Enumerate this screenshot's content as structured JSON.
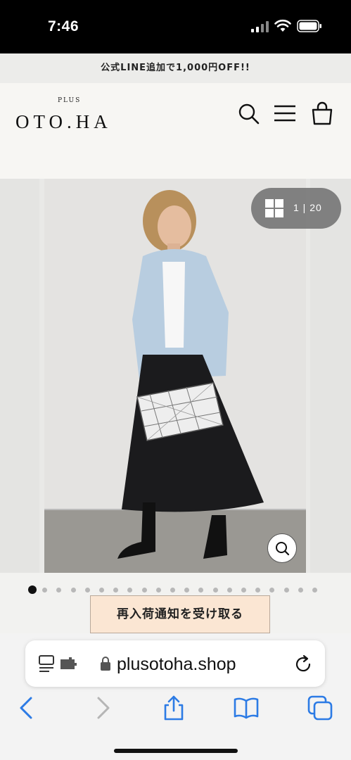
{
  "status_bar": {
    "time": "7:46"
  },
  "promo": {
    "text": "公式LINE追加で1,000円OFF!!"
  },
  "header": {
    "logo_small": "PLUS",
    "logo": "OTO.HA",
    "icons": [
      "search-icon",
      "menu-icon",
      "shopping-bag-icon"
    ]
  },
  "gallery": {
    "counter": "1 | 20",
    "current_image": 1,
    "total_images": 20,
    "dot_count": 21,
    "active_dot": 0
  },
  "product": {
    "restock_label": "再入荷通知を受け取る"
  },
  "browser": {
    "url": "plusotoha.shop",
    "toolbar_icons": [
      "back-icon",
      "forward-icon",
      "share-icon",
      "bookmarks-icon",
      "tabs-icon"
    ],
    "accent_color": "#2c7be5"
  }
}
